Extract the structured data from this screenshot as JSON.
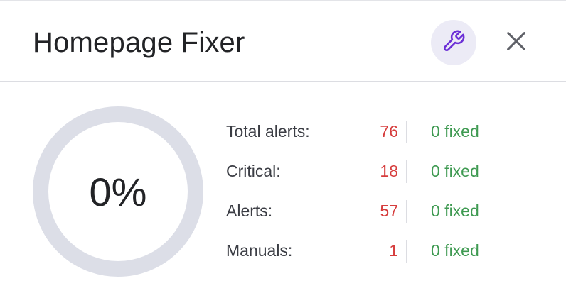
{
  "header": {
    "title": "Homepage Fixer",
    "tool_icon": "wrench-icon",
    "close_icon": "close-icon",
    "accent_color": "#6b2fd6"
  },
  "progress": {
    "label": "0%",
    "value": 0
  },
  "stats": [
    {
      "label": "Total alerts:",
      "count": "76",
      "fixed": "0 fixed"
    },
    {
      "label": "Critical:",
      "count": "18",
      "fixed": "0 fixed"
    },
    {
      "label": "Alerts:",
      "count": "57",
      "fixed": "0 fixed"
    },
    {
      "label": "Manuals:",
      "count": "1",
      "fixed": "0 fixed"
    }
  ],
  "colors": {
    "count": "#d63d3d",
    "fixed": "#3f9a52",
    "ring_track": "#dcdee7"
  }
}
